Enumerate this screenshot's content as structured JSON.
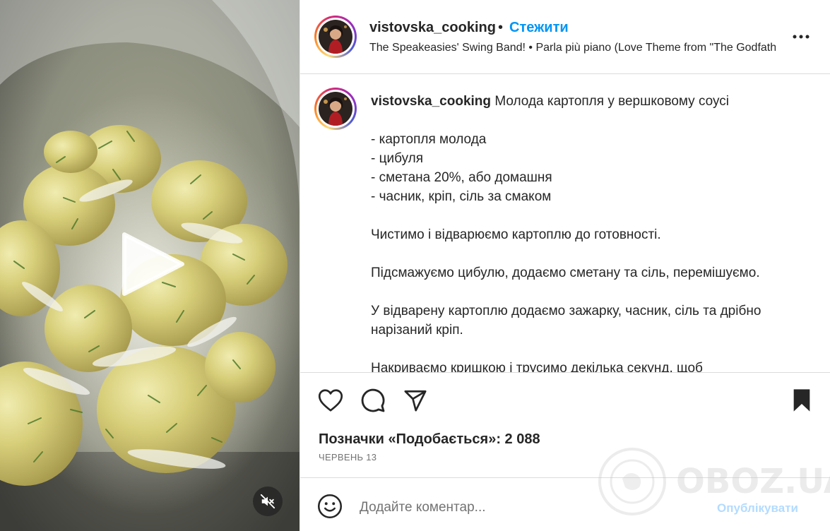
{
  "media": {
    "play_icon": "play-icon",
    "mute_icon": "muted-speaker-icon"
  },
  "header": {
    "username": "vistovska_cooking",
    "separator": "•",
    "follow_label": "Стежити",
    "audio_text": "The Speakeasies' Swing Band! • Parla più piano (Love Theme from \"The Godfather\")",
    "more_icon": "more-options-icon"
  },
  "caption": {
    "username": "vistovska_cooking",
    "title": "Молода картопля у вершковому соусі",
    "ingredients": [
      "- картопля молода",
      "- цибуля",
      "- сметана 20%, або домашня",
      "- часник, кріп, сіль за смаком"
    ],
    "steps": [
      "Чистимо і відварюємо картоплю до готовності.",
      "Підсмажуємо цибулю, додаємо сметану та сіль, перемішуємо.",
      "У відварену картоплю додаємо зажарку, часник, сіль та дрібно нарізаний кріп.",
      "Накриваємо кришкою і трусимо декілька секунд, щоб"
    ]
  },
  "actions": {
    "like_icon": "heart-icon",
    "comment_icon": "comment-bubble-icon",
    "share_icon": "paper-plane-icon",
    "save_icon": "bookmark-icon"
  },
  "likes_text": "Позначки «Подобається»: 2 088",
  "date_text": "ЧЕРВЕНЬ 13",
  "comment": {
    "emoji_icon": "smiley-icon",
    "placeholder": "Додайте коментар...",
    "post_label": "Опублікувати"
  },
  "watermark_text": "OBOZ.UA",
  "colors": {
    "link_blue": "#0095f6",
    "post_disabled": "#b3dbff",
    "text": "#262626",
    "secondary": "#737373",
    "border": "#dbdbdb"
  }
}
